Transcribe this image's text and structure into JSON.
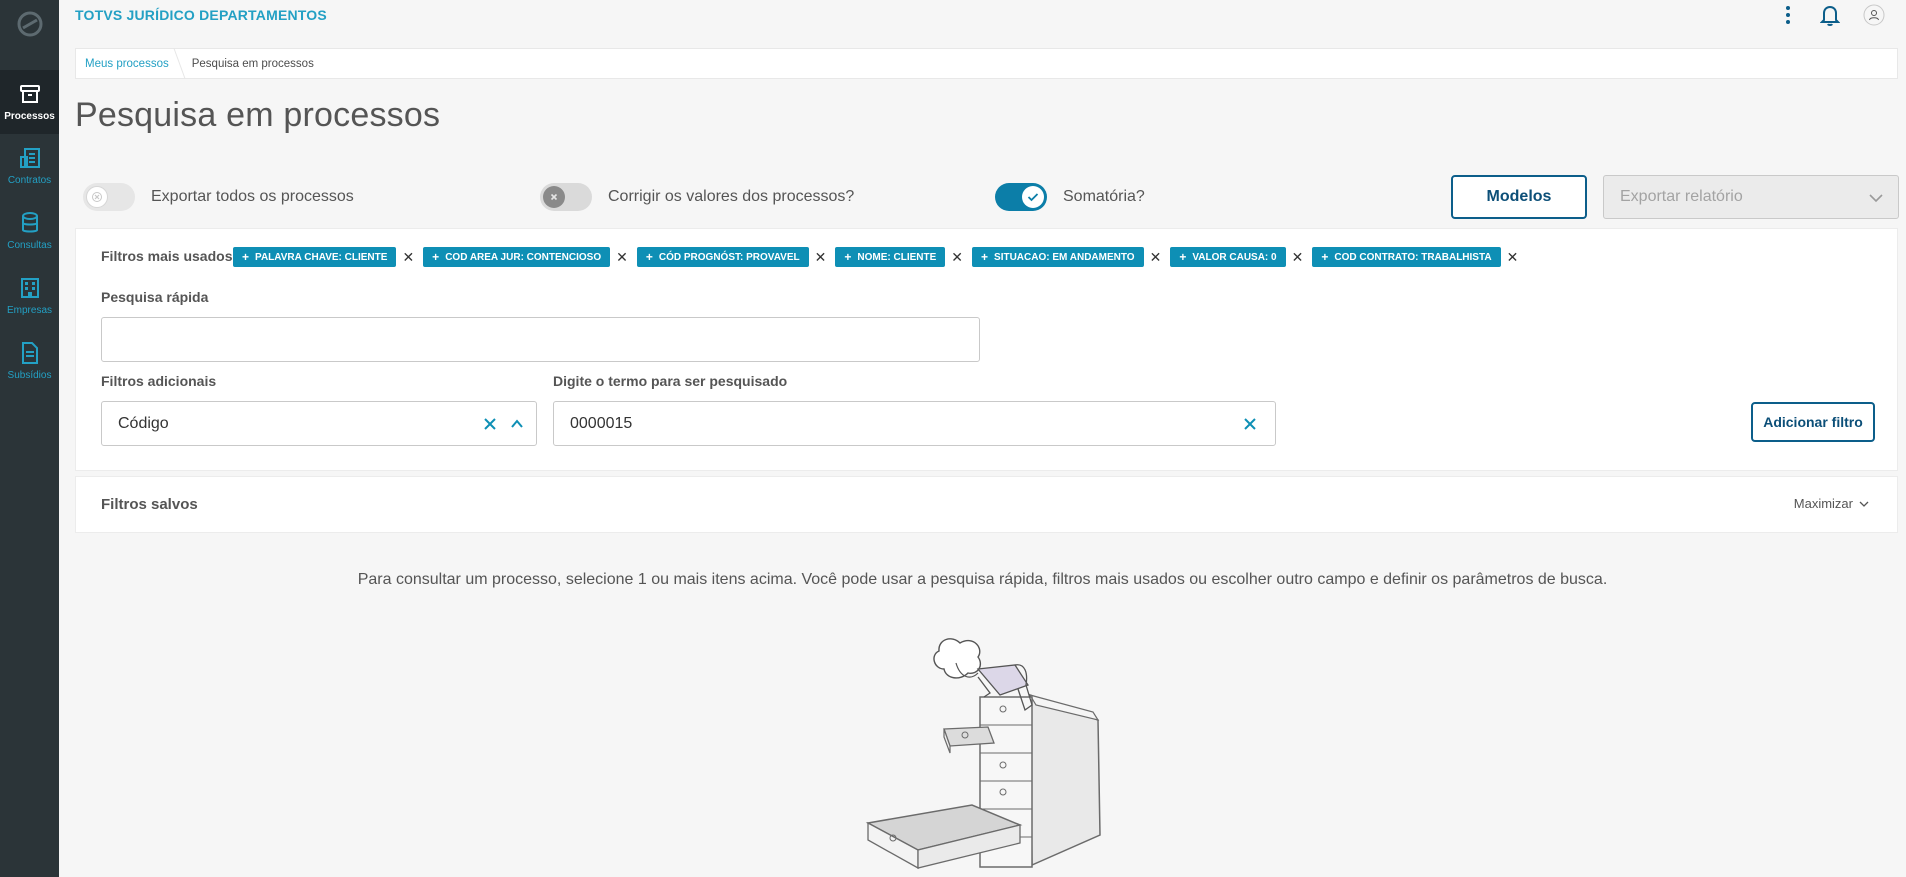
{
  "app": {
    "title": "TOTVS JURÍDICO DEPARTAMENTOS"
  },
  "sidebar": {
    "items": [
      {
        "label": "Processos",
        "icon": "archive-icon",
        "active": true
      },
      {
        "label": "Contratos",
        "icon": "contracts-icon"
      },
      {
        "label": "Consultas",
        "icon": "database-icon"
      },
      {
        "label": "Empresas",
        "icon": "building-icon"
      },
      {
        "label": "Subsídios",
        "icon": "document-icon"
      }
    ]
  },
  "breadcrumb": {
    "parent": "Meus processos",
    "current": "Pesquisa em processos"
  },
  "page": {
    "title": "Pesquisa em processos"
  },
  "toolbar": {
    "export_all_label": "Exportar todos os processos",
    "correct_values_label": "Corrigir os valores dos processos?",
    "sum_label": "Somatória?",
    "modelos_label": "Modelos",
    "export_report_placeholder": "Exportar relatório"
  },
  "filters": {
    "most_used_label": "Filtros mais usados",
    "tags": [
      "PALAVRA CHAVE: CLIENTE",
      "COD AREA JUR: CONTENCIOSO",
      "CÓD PROGNÓST: PROVAVEL",
      "NOME: CLIENTE",
      "SITUACAO: EM ANDAMENTO",
      "VALOR CAUSA: 0",
      "COD CONTRATO: TRABALHISTA"
    ],
    "quick_search_label": "Pesquisa rápida",
    "quick_search_value": "",
    "additional_label": "Filtros adicionais",
    "additional_value": "Código",
    "term_label": "Digite o termo para ser pesquisado",
    "term_value": "0000015",
    "add_filter_label": "Adicionar filtro"
  },
  "saved_filters": {
    "title": "Filtros salvos",
    "maximize_label": "Maximizar"
  },
  "empty_hint": "Para consultar um processo, selecione 1 ou mais itens acima. Você pode usar a pesquisa rápida, filtros mais usados ou escolher outro campo e definir os parâmetros de busca.",
  "colors": {
    "accent": "#23a0c4",
    "tag": "#0e8fb5",
    "primary_dark": "#0c5e8a",
    "sidebar": "#2b3438"
  }
}
